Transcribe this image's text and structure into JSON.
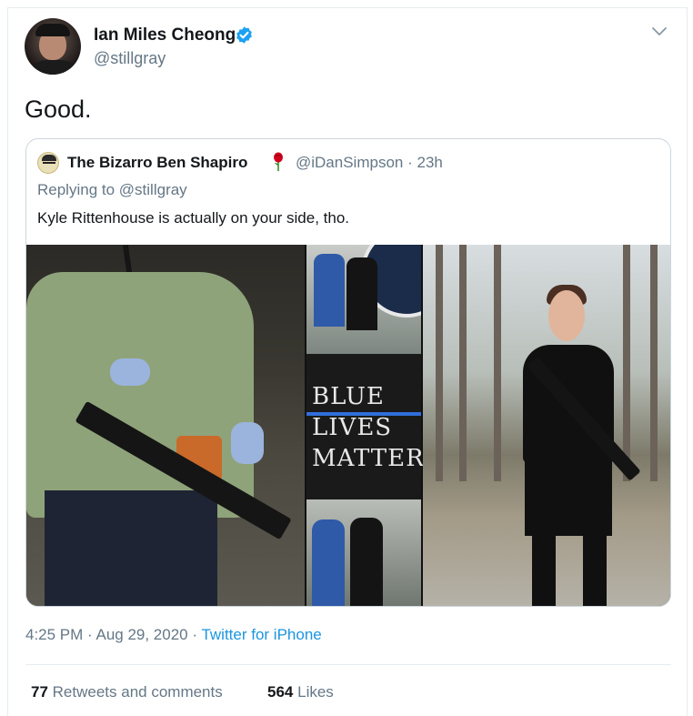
{
  "tweet": {
    "author_name": "Ian Miles Cheong",
    "author_handle": "@stillgray",
    "text": "Good.",
    "timestamp": "4:25 PM",
    "date": "Aug 29, 2020",
    "source": "Twitter for iPhone",
    "retweets_count": "77",
    "retweets_label": "Retweets and comments",
    "likes_count": "564",
    "likes_label": "Likes"
  },
  "quoted_tweet": {
    "author_name": "The Bizarro Ben Shapiro",
    "author_handle": "@iDanSimpson",
    "age": "23h",
    "replying_prefix": "Replying to",
    "replying_to": "@stillgray",
    "text": "Kyle Rittenhouse is actually on your side, tho.",
    "media_caption": [
      "BLUE",
      "LIVES",
      "MATTER"
    ]
  },
  "colors": {
    "verified": "#1da1f2",
    "link": "#1b95e0",
    "secondary_text": "#657786",
    "primary_text": "#14171a",
    "rose": "#d0021b"
  },
  "icons": {
    "verified": "verified-badge-icon",
    "menu": "chevron-down-icon",
    "rose": "rose-emoji-icon"
  }
}
